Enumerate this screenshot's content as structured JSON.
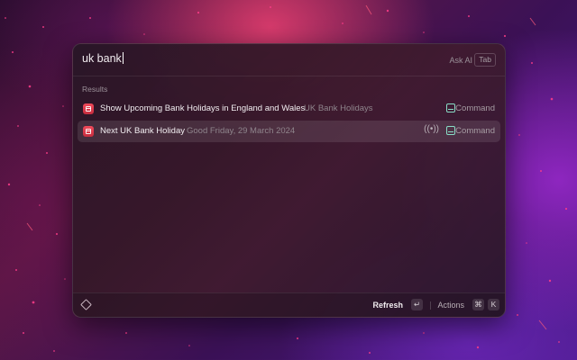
{
  "search": {
    "query": "uk bank"
  },
  "ask_ai": {
    "label": "Ask AI",
    "key": "Tab"
  },
  "results": {
    "section_label": "Results",
    "items": [
      {
        "title": "Show Upcoming Bank Holidays in England and Wales",
        "subtitle": "UK Bank Holidays",
        "type": "Command",
        "icon": "calendar-icon",
        "type_icon": "command-icon"
      },
      {
        "title": "Next UK Bank Holiday",
        "subtitle": "Good Friday, 29 March 2024",
        "type": "Command",
        "icon": "calendar-icon",
        "type_icon": "command-icon",
        "accessory_icon": "live-broadcast-icon"
      }
    ]
  },
  "footer": {
    "primary_action": "Refresh",
    "primary_key": "↵",
    "actions_label": "Actions",
    "actions_keys": [
      "⌘",
      "K"
    ]
  },
  "colors": {
    "accent_icon": "#e8384f",
    "command_icon": "#88dcc6"
  }
}
